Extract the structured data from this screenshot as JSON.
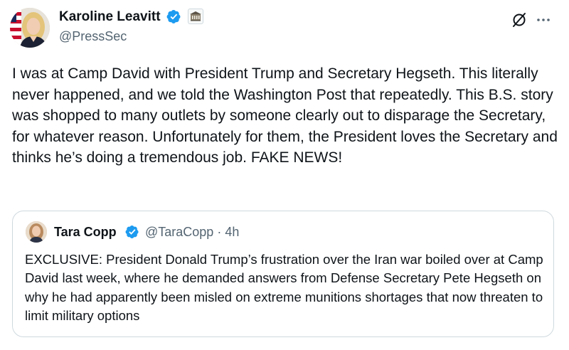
{
  "post": {
    "author": {
      "name": "Karoline Leavitt",
      "handle": "@PressSec",
      "verified_icon": "verified-badge-icon",
      "affiliate_icon": "white-house-seal-icon"
    },
    "text": "I was at Camp David with President Trump and Secretary Hegseth. This literally never happened, and we told the Washington Post that repeatedly. This B.S. story was shopped to many outlets by someone clearly out to disparage the Secretary, for whatever reason. Unfortunately for them, the President loves the Secretary and thinks he’s doing a tremendous job. FAKE NEWS!",
    "actions": {
      "grok_icon": "grok-icon",
      "more_icon": "more-options-icon"
    }
  },
  "quote": {
    "author": {
      "name": "Tara Copp",
      "handle": "@TaraCopp",
      "separator": "·",
      "time": "4h"
    },
    "text": "EXCLUSIVE: President Donald Trump’s frustration over the Iran war boiled over at Camp David last week, where he demanded answers from Defense Secretary Pete Hegseth on why he had apparently been misled on extreme munitions shortages that now threaten to limit military options"
  },
  "colors": {
    "text": "#0f1419",
    "secondary_text": "#536471",
    "verified_blue": "#1d9bf0",
    "border": "#cfd9de"
  }
}
